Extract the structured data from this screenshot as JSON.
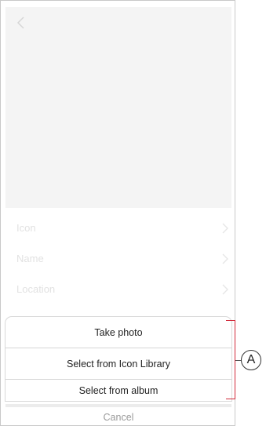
{
  "settings": {
    "items": [
      {
        "label": "Icon"
      },
      {
        "label": "Name"
      },
      {
        "label": "Location"
      }
    ]
  },
  "action_sheet": {
    "options": [
      {
        "label": "Take photo"
      },
      {
        "label": "Select from Icon Library"
      },
      {
        "label": "Select from album"
      }
    ],
    "cancel_label": "Cancel"
  },
  "callout": {
    "label": "A",
    "color": "#d12a3a"
  },
  "icons": {
    "back": "chevron-left-icon",
    "row_chevron": "chevron-right-icon"
  }
}
